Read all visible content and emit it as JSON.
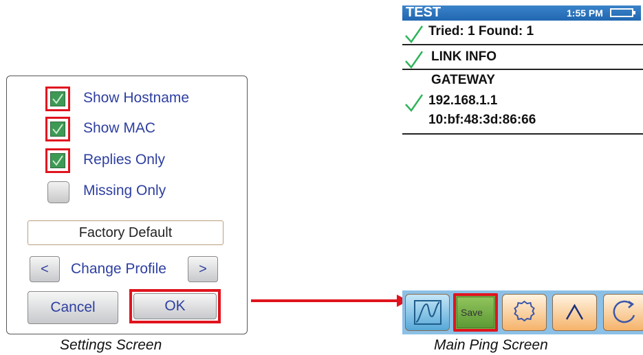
{
  "settings": {
    "options": [
      {
        "label": "Show Hostname",
        "checked": true
      },
      {
        "label": "Show MAC",
        "checked": true
      },
      {
        "label": "Replies Only",
        "checked": true
      },
      {
        "label": "Missing Only",
        "checked": false
      }
    ],
    "profile_name": "Factory Default",
    "prev_label": "<",
    "next_label": ">",
    "change_profile_label": "Change Profile",
    "cancel_label": "Cancel",
    "ok_label": "OK",
    "caption": "Settings Screen"
  },
  "ping": {
    "header_title": "TEST",
    "time": "1:55 PM",
    "result_summary": "Tried: 1 Found: 1",
    "link_info": "LINK INFO",
    "gateway_label": "GATEWAY",
    "gateway_ip": "192.168.1.1",
    "gateway_mac": "10:bf:48:3d:86:66",
    "save_label": "Save",
    "caption": "Main Ping Screen"
  },
  "colors": {
    "highlight": "#e0141e",
    "label_blue": "#2e3fa0",
    "header_blue": "#2067b1",
    "check_green": "#2fb35a",
    "toolbar_bg": "#8cc0e6"
  },
  "icons": [
    "checkmark-icon",
    "graph-icon",
    "save-folder-icon",
    "gear-icon",
    "chevron-up-icon",
    "refresh-icon",
    "battery-icon"
  ]
}
